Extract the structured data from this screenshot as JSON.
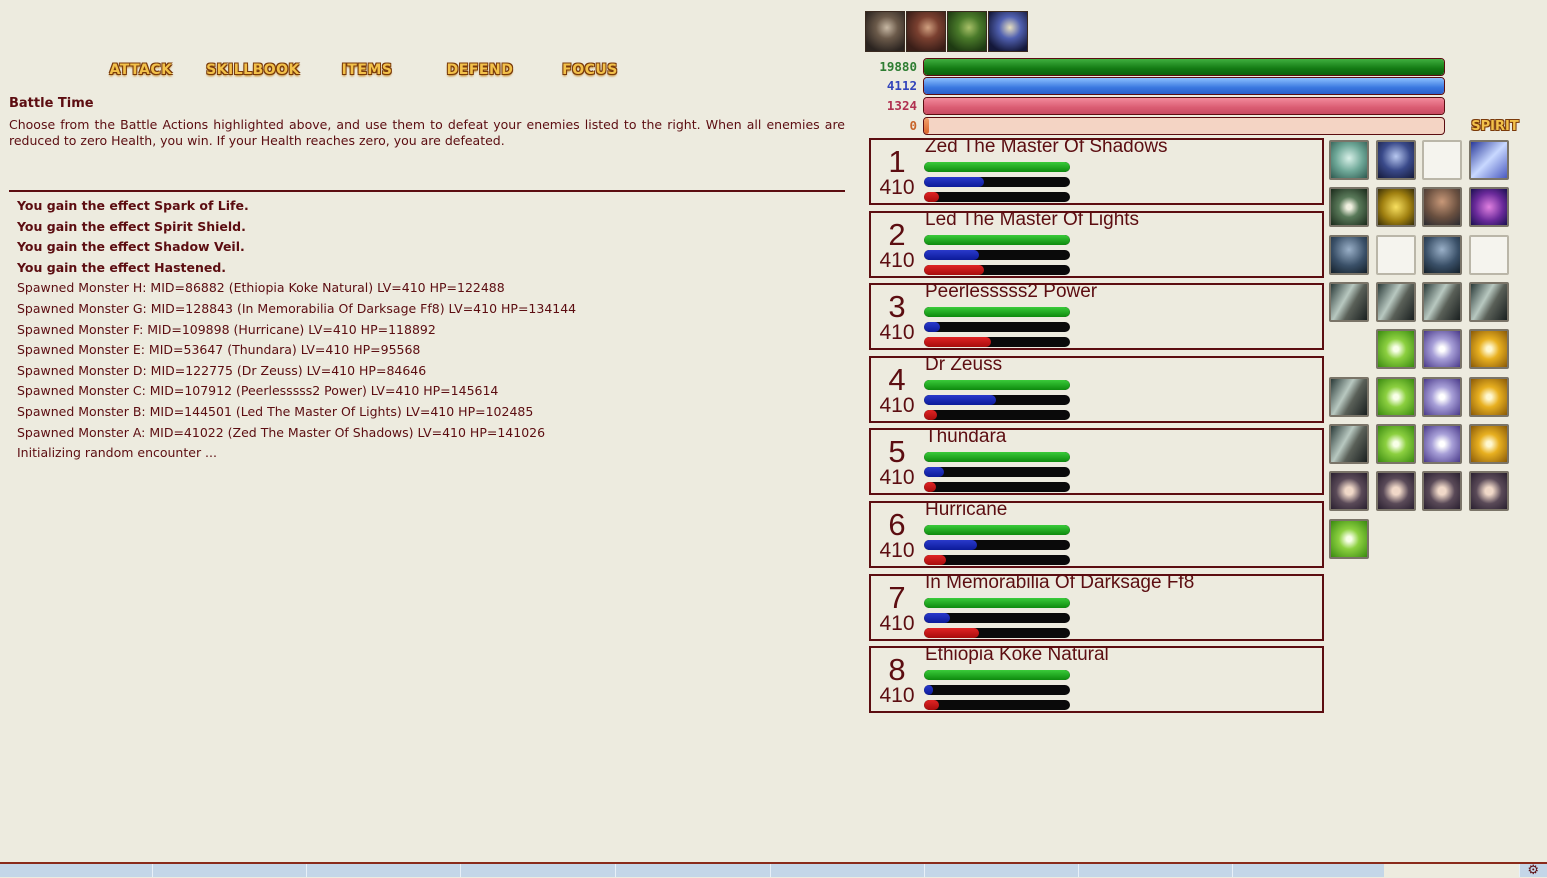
{
  "actions": {
    "attack": "ATTACK",
    "skillbook": "SKILLBOOK",
    "items": "ITEMS",
    "defend": "DEFEND",
    "focus": "FOCUS",
    "spirit": "SPIRIT"
  },
  "battle": {
    "title": "Battle Time",
    "description": "Choose from the Battle Actions highlighted above, and use them to defeat your enemies listed to the right. When all enemies are reduced to zero Health, you win. If your Health reaches zero, you are defeated."
  },
  "log": [
    {
      "text": "You gain the effect Spark of Life.",
      "bold": true
    },
    {
      "text": "You gain the effect Spirit Shield.",
      "bold": true
    },
    {
      "text": "You gain the effect Shadow Veil.",
      "bold": true
    },
    {
      "text": "You gain the effect Hastened.",
      "bold": true
    },
    {
      "text": "Spawned Monster H: MID=86882 (Ethiopia Koke Natural) LV=410 HP=122488",
      "bold": false
    },
    {
      "text": "Spawned Monster G: MID=128843 (In Memorabilia Of Darksage Ff8) LV=410 HP=134144",
      "bold": false
    },
    {
      "text": "Spawned Monster F: MID=109898 (Hurricane) LV=410 HP=118892",
      "bold": false
    },
    {
      "text": "Spawned Monster E: MID=53647 (Thundara) LV=410 HP=95568",
      "bold": false
    },
    {
      "text": "Spawned Monster D: MID=122775 (Dr Zeuss) LV=410 HP=84646",
      "bold": false
    },
    {
      "text": "Spawned Monster C: MID=107912 (Peerlesssss2 Power) LV=410 HP=145614",
      "bold": false
    },
    {
      "text": "Spawned Monster B: MID=144501 (Led The Master Of Lights) LV=410 HP=102485",
      "bold": false
    },
    {
      "text": "Spawned Monster A: MID=41022 (Zed The Master Of Shadows) LV=410 HP=141026",
      "bold": false
    },
    {
      "text": "Initializing random encounter ...",
      "bold": false
    }
  ],
  "player": {
    "portraits": [
      "portrait-1-icon",
      "portrait-2-icon",
      "portrait-3-icon",
      "portrait-4-icon"
    ],
    "vitals": [
      {
        "name": "health",
        "value": "19880",
        "fill": 1.0,
        "color": "#2E7D32"
      },
      {
        "name": "magic",
        "value": "4112",
        "fill": 1.0,
        "color": "#3355CC"
      },
      {
        "name": "spirit",
        "value": "1324",
        "fill": 1.0,
        "color": "#B03050"
      },
      {
        "name": "overcharge",
        "value": "0",
        "fill": 0.005,
        "color": "#D2691E"
      }
    ]
  },
  "monsters": [
    {
      "num": "1",
      "level": "410",
      "name": "Zed The Master Of Shadows",
      "hp": 1.0,
      "mp": 0.41,
      "sp": 0.1
    },
    {
      "num": "2",
      "level": "410",
      "name": "Led The Master Of Lights",
      "hp": 1.0,
      "mp": 0.38,
      "sp": 0.41
    },
    {
      "num": "3",
      "level": "410",
      "name": "Peerlesssss2 Power",
      "hp": 1.0,
      "mp": 0.11,
      "sp": 0.46
    },
    {
      "num": "4",
      "level": "410",
      "name": "Dr Zeuss",
      "hp": 1.0,
      "mp": 0.49,
      "sp": 0.09
    },
    {
      "num": "5",
      "level": "410",
      "name": "Thundara",
      "hp": 1.0,
      "mp": 0.14,
      "sp": 0.08
    },
    {
      "num": "6",
      "level": "410",
      "name": "Hurricane",
      "hp": 1.0,
      "mp": 0.36,
      "sp": 0.15
    },
    {
      "num": "7",
      "level": "410",
      "name": "In Memorabilia Of Darksage Ff8",
      "hp": 1.0,
      "mp": 0.18,
      "sp": 0.38
    },
    {
      "num": "8",
      "level": "410",
      "name": "Ethiopia Koke Natural",
      "hp": 1.0,
      "mp": 0.06,
      "sp": 0.1
    }
  ],
  "effects": {
    "rows": [
      [
        "spirit-shield-icon",
        "shadow-veil-icon",
        "empty",
        "hastened-icon"
      ],
      [
        "spark-of-life-icon",
        "protection-icon",
        "absorb-icon",
        "arcane-icon"
      ],
      [
        "monk-icon",
        "empty",
        "monk-icon",
        "empty"
      ],
      [
        "claw-debuff-icon",
        "claw-debuff-icon",
        "claw-debuff-icon",
        "claw-debuff-icon"
      ],
      [
        "none",
        "regen-icon",
        "heal-icon",
        "holy-icon"
      ],
      [
        "claw-debuff-icon",
        "regen-icon",
        "heal-icon",
        "holy-icon"
      ],
      [
        "claw-debuff-icon",
        "regen-icon",
        "heal-icon",
        "holy-icon"
      ],
      [
        "rune-icon",
        "rune-icon",
        "rune-icon",
        "rune-icon"
      ],
      [
        "regen-icon",
        "none",
        "none",
        "none"
      ]
    ]
  }
}
